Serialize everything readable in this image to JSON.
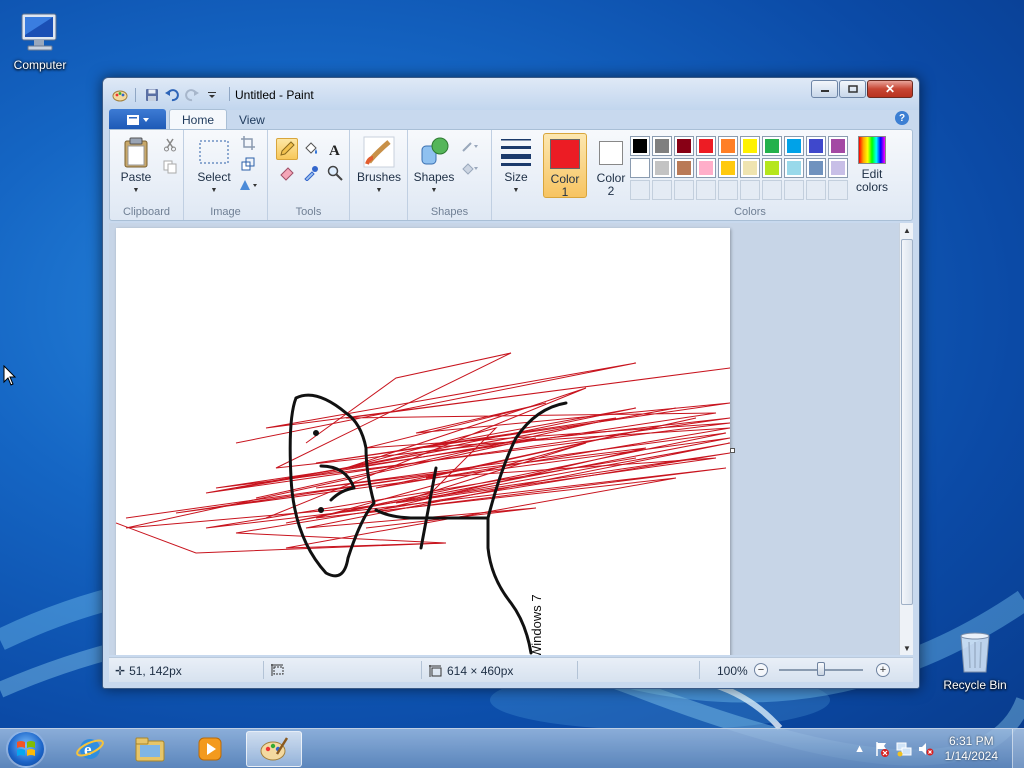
{
  "desktop": {
    "icons": [
      {
        "label": "Computer",
        "icon": "computer-icon"
      },
      {
        "label": "Recycle Bin",
        "icon": "recycle-bin-icon"
      }
    ]
  },
  "window": {
    "title": "Untitled - Paint",
    "tabs": [
      "Home",
      "View"
    ],
    "ribbon": {
      "clipboard": {
        "paste_label": "Paste",
        "group_label": "Clipboard"
      },
      "image": {
        "select_label": "Select",
        "group_label": "Image"
      },
      "tools": {
        "group_label": "Tools"
      },
      "brushes": {
        "label": "Brushes"
      },
      "shapes": {
        "label": "Shapes",
        "group_label": "Shapes"
      },
      "size": {
        "label": "Size"
      },
      "colors": {
        "color1_label_line1": "Color",
        "color1_label_line2": "1",
        "color2_label_line1": "Color",
        "color2_label_line2": "2",
        "color1_value": "#ec1c24",
        "color2_value": "#ffffff",
        "edit_label_line1": "Edit",
        "edit_label_line2": "colors",
        "group_label": "Colors",
        "palette_row1": [
          "#000000",
          "#7f7f7f",
          "#880015",
          "#ed1c24",
          "#ff7f27",
          "#fff200",
          "#22b14c",
          "#00a2e8",
          "#3f48cc",
          "#a349a4"
        ],
        "palette_row2": [
          "#ffffff",
          "#c3c3c3",
          "#b97a57",
          "#ffaec9",
          "#ffc90e",
          "#efe4b0",
          "#b5e61d",
          "#99d9ea",
          "#7092be",
          "#c8bfe7"
        ]
      }
    },
    "canvas": {
      "rotated_text": "Windows 7"
    },
    "status": {
      "cursor_pos": "51, 142px",
      "image_size": "614 × 460px",
      "zoom": "100%"
    }
  },
  "taskbar": {
    "time": "6:31 PM",
    "date": "1/14/2024"
  }
}
